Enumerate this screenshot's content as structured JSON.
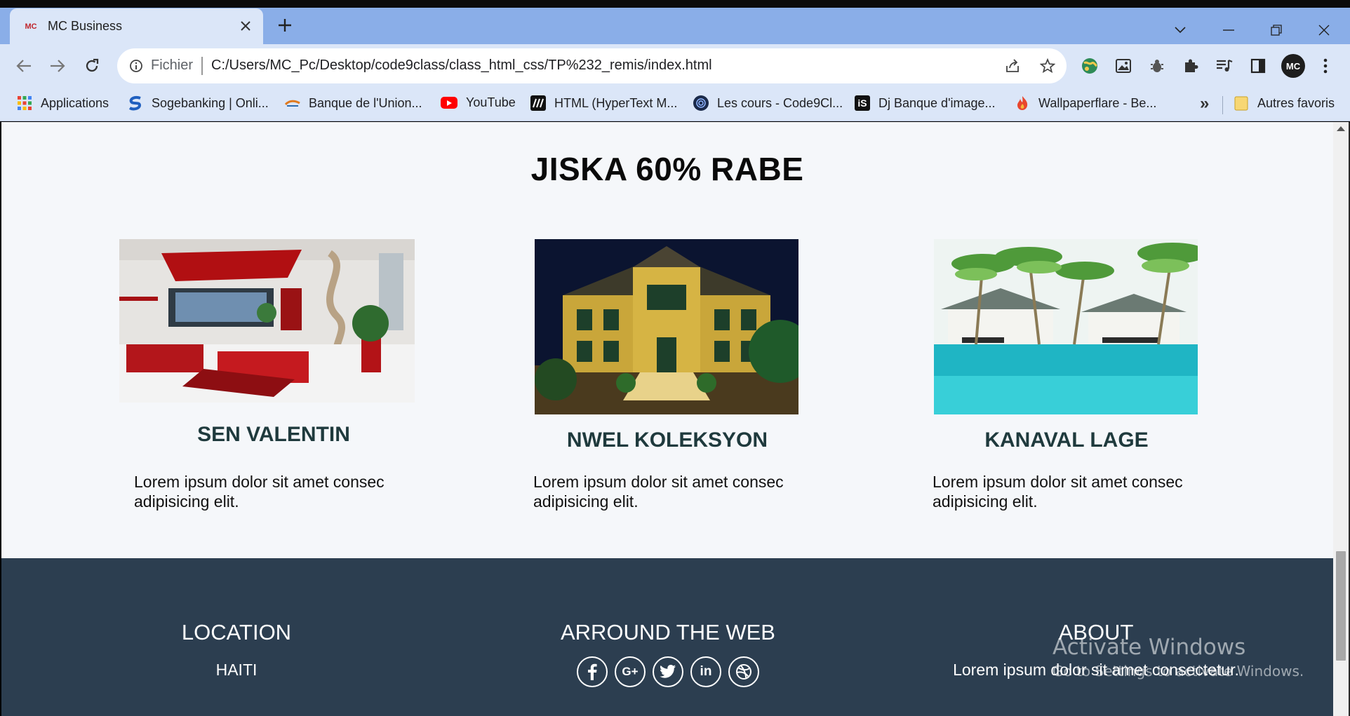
{
  "browser": {
    "tab_title": "MC Business",
    "tab_favicon_text": "MC",
    "omnibox_scheme": "Fichier",
    "url": "C:/Users/MC_Pc/Desktop/code9class/class_html_css/TP%232_remis/index.html",
    "profile_initials": "MC",
    "bookmarks": [
      {
        "label": "Applications",
        "icon": "apps-grid-icon"
      },
      {
        "label": "Sogebanking | Onli...",
        "icon": "sogebank-icon",
        "color": "#1f5fbf"
      },
      {
        "label": "Banque de l'Union...",
        "icon": "bank-union-icon",
        "color": "#e07a1f"
      },
      {
        "label": "YouTube",
        "icon": "youtube-icon",
        "color": "#ff0000"
      },
      {
        "label": "HTML (HyperText M...",
        "icon": "mdn-icon",
        "color": "#111111"
      },
      {
        "label": "Les cours - Code9Cl...",
        "icon": "code9class-icon",
        "color": "#1b2a4a"
      },
      {
        "label": "Dj Banque d'image...",
        "icon": "istock-icon",
        "color": "#111111"
      },
      {
        "label": "Wallpaperflare - Be...",
        "icon": "wallpaperflare-icon",
        "color": "#e8462e"
      }
    ],
    "bookmarks_more": "»",
    "other_bookmarks": "Autres favoris"
  },
  "page": {
    "section_title": "JISKA 60% RABE",
    "cards": [
      {
        "title": "SEN VALENTIN",
        "text": "Lorem ipsum dolor sit amet consec adipisicing elit.",
        "image": "living-room-photo"
      },
      {
        "title": "NWEL KOLEKSYON",
        "text": "Lorem ipsum dolor sit amet consec adipisicing elit.",
        "image": "mansion-photo"
      },
      {
        "title": "KANAVAL LAGE",
        "text": "Lorem ipsum dolor sit amet consec adipisicing elit.",
        "image": "resort-pool-photo"
      }
    ],
    "footer": {
      "location_heading": "LOCATION",
      "location_text": "HAITI",
      "web_heading": "ARROUND THE WEB",
      "social_icons": [
        "facebook-icon",
        "google-plus-icon",
        "twitter-icon",
        "linkedin-icon",
        "dribbble-icon"
      ],
      "about_heading": "ABOUT",
      "about_text": "Lorem ipsum dolor sit amet consectetur.",
      "background_color": "#2c3e50"
    }
  },
  "os": {
    "watermark_line1": "Activate Windows",
    "watermark_line2": "Go to Settings to activate Windows."
  }
}
